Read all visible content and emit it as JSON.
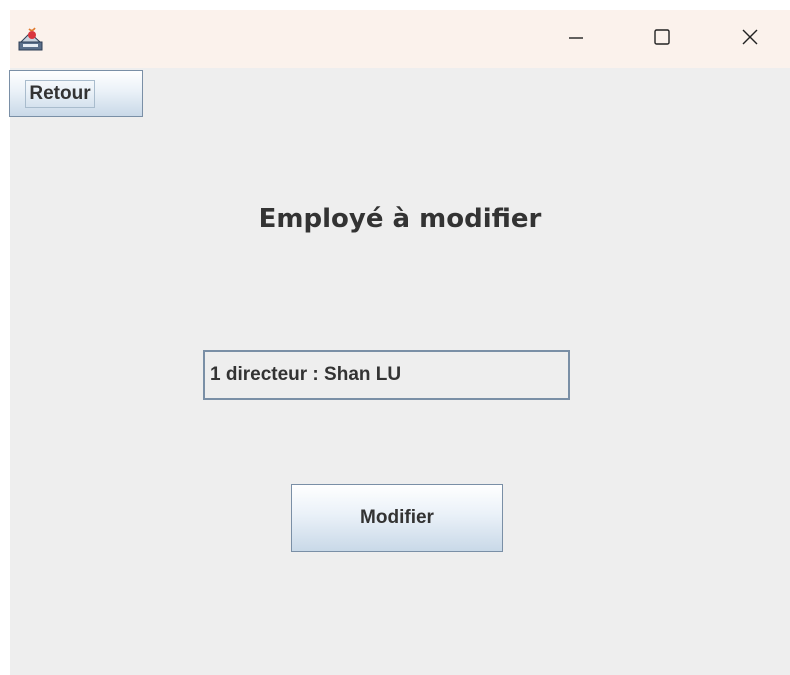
{
  "titlebar": {
    "icons": {
      "app": "java-app-icon",
      "minimize": "minimize-icon",
      "maximize": "maximize-icon",
      "close": "close-icon"
    }
  },
  "main": {
    "back_button_label": "Retour",
    "title": "Employé à modifier",
    "employee_select_value": "1 directeur : Shan LU",
    "modify_button_label": "Modifier"
  },
  "colors": {
    "titlebar_background": "#fbf2ec",
    "content_background": "#eeeeee",
    "button_border": "#7a8fa6",
    "text": "#333333"
  }
}
